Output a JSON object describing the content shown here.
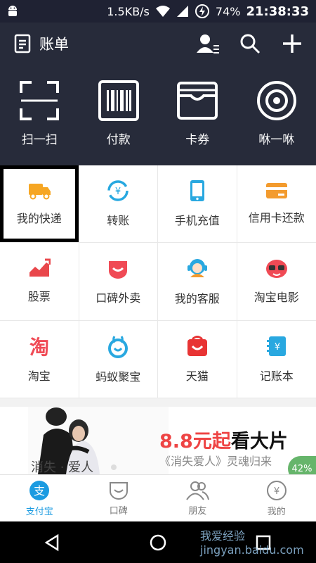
{
  "status": {
    "speed": "1.5KB/s",
    "battery": "74%",
    "time": "21:38:33"
  },
  "header": {
    "bill_label": "账单",
    "quick_actions": [
      {
        "label": "扫一扫",
        "icon": "scan-icon"
      },
      {
        "label": "付款",
        "icon": "barcode-icon"
      },
      {
        "label": "卡券",
        "icon": "wallet-icon"
      },
      {
        "label": "咻一咻",
        "icon": "target-icon"
      }
    ]
  },
  "services": [
    {
      "label": "我的快递",
      "icon": "delivery-truck-icon",
      "color": "#f6a623"
    },
    {
      "label": "转账",
      "icon": "transfer-icon",
      "color": "#27a8e0"
    },
    {
      "label": "手机充值",
      "icon": "phone-recharge-icon",
      "color": "#29a8e0"
    },
    {
      "label": "信用卡还款",
      "icon": "credit-card-icon",
      "color": "#f39b2e"
    },
    {
      "label": "股票",
      "icon": "stock-chart-icon",
      "color": "#e9474b"
    },
    {
      "label": "口碑外卖",
      "icon": "koubei-icon",
      "color": "#f04a55"
    },
    {
      "label": "我的客服",
      "icon": "customer-service-icon",
      "color": "#29a8e0"
    },
    {
      "label": "淘宝电影",
      "icon": "taobao-movie-icon",
      "color": "#f04a55"
    },
    {
      "label": "淘宝",
      "icon": "taobao-icon",
      "color": "#f04a55"
    },
    {
      "label": "蚂蚁聚宝",
      "icon": "ant-fortune-icon",
      "color": "#29a8e0"
    },
    {
      "label": "天猫",
      "icon": "tmall-icon",
      "color": "#e83434"
    },
    {
      "label": "记账本",
      "icon": "account-book-icon",
      "color": "#29a8e0"
    }
  ],
  "banner": {
    "price": "8.8元起",
    "headline": "看大片",
    "subtitle": "《消失爱人》灵魂归来",
    "poster_text": "消失 · 爱人"
  },
  "progress": "42%",
  "tabs": [
    {
      "label": "支付宝",
      "icon": "alipay-icon"
    },
    {
      "label": "口碑",
      "icon": "koubei-tab-icon"
    },
    {
      "label": "朋友",
      "icon": "friends-icon"
    },
    {
      "label": "我的",
      "icon": "my-icon"
    }
  ],
  "watermark": "我爱经验 jingyan.baidu.com"
}
